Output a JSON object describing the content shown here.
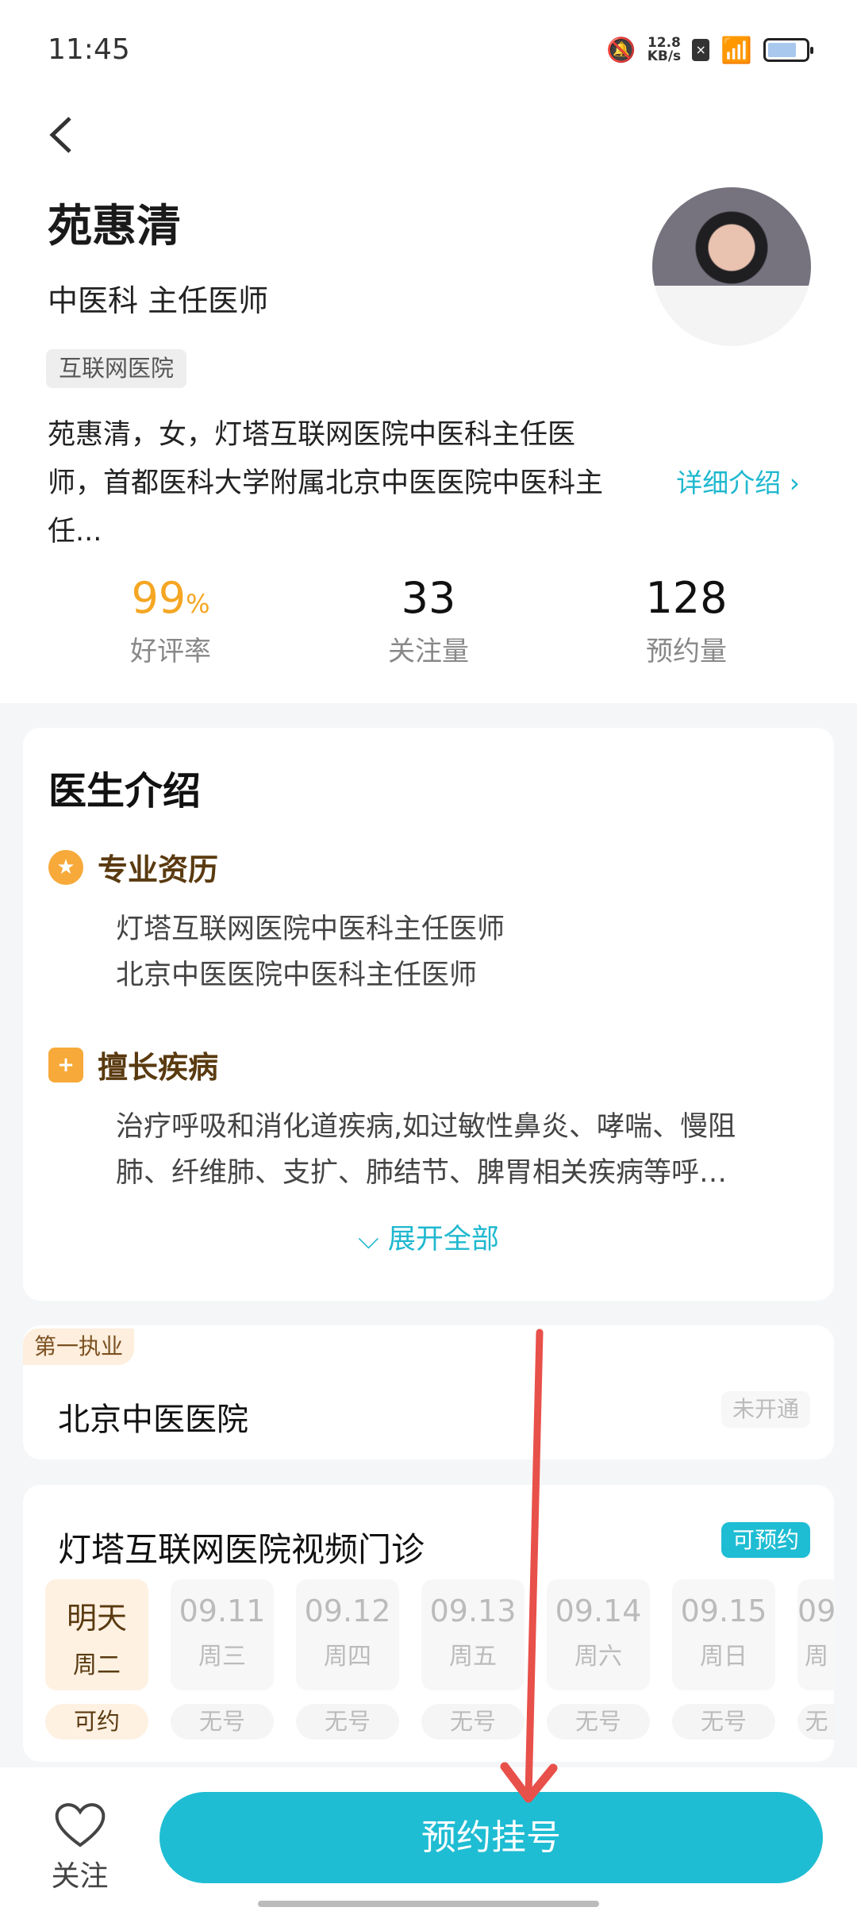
{
  "status": {
    "time": "11:45",
    "speed": "12.8",
    "speed_unit": "KB/s"
  },
  "doctor": {
    "name": "苑惠清",
    "title": "中医科 主任医师",
    "tag": "互联网医院",
    "desc": "苑惠清，女，灯塔互联网医院中医科主任医师，首都医科大学附属北京中医医院中医科主任...",
    "more": "详细介绍"
  },
  "stats": [
    {
      "value": "99",
      "unit": "%",
      "label": "好评率"
    },
    {
      "value": "33",
      "label": "关注量"
    },
    {
      "value": "128",
      "label": "预约量"
    }
  ],
  "intro": {
    "heading": "医生介绍",
    "qual_h": "专业资历",
    "qual": [
      "灯塔互联网医院中医科主任医师",
      "北京中医医院中医科主任医师"
    ],
    "spec_h": "擅长疾病",
    "spec": [
      "治疗呼吸和消化道疾病,如过敏性鼻炎、哮喘、慢阻",
      "肺、纤维肺、支扩、肺结节、脾胃相关疾病等呼…"
    ],
    "expand": "展开全部"
  },
  "practice": {
    "badge": "第一执业",
    "hospital": "北京中医医院",
    "status": "未开通"
  },
  "video": {
    "title": "灯塔互联网医院视频门诊",
    "badge": "可预约",
    "days": [
      {
        "d": "明天",
        "w": "周二",
        "s": "可约"
      },
      {
        "d": "09.11",
        "w": "周三",
        "s": "无号"
      },
      {
        "d": "09.12",
        "w": "周四",
        "s": "无号"
      },
      {
        "d": "09.13",
        "w": "周五",
        "s": "无号"
      },
      {
        "d": "09.14",
        "w": "周六",
        "s": "无号"
      },
      {
        "d": "09.15",
        "w": "周日",
        "s": "无号"
      },
      {
        "d": "09",
        "w": "周",
        "s": "无"
      }
    ]
  },
  "bottom": {
    "follow": "关注",
    "book": "预约挂号"
  },
  "colors": {
    "accent": "#1fbdd3",
    "orange": "#f7a93a",
    "annotation": "#e8504a"
  }
}
